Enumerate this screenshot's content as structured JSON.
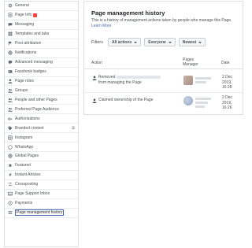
{
  "sidebar": {
    "items": [
      {
        "label": "General",
        "icon": "gear-icon"
      },
      {
        "label": "Page Info",
        "icon": "info-icon",
        "badge": true
      },
      {
        "label": "Messaging",
        "icon": "chat-icon"
      },
      {
        "label": "Templates and tabs",
        "icon": "grid-icon"
      },
      {
        "label": "Post attribution",
        "icon": "flag-icon"
      },
      {
        "label": "Notifications",
        "icon": "globe-icon"
      },
      {
        "label": "Advanced messaging",
        "icon": "chat-bubble-icon"
      },
      {
        "label": "Facebook badges",
        "icon": "badge-icon"
      },
      {
        "label": "Page roles",
        "icon": "person-icon"
      },
      {
        "label": "Groups",
        "icon": "people-icon"
      },
      {
        "label": "People and other Pages",
        "icon": "people-icon"
      },
      {
        "label": "Preferred Page Audience",
        "icon": "people-icon"
      },
      {
        "label": "Authorisations",
        "icon": "key-icon"
      },
      {
        "label": "Branded content",
        "icon": "tag-icon",
        "trail": "⧉"
      },
      {
        "label": "Instagram",
        "icon": "instagram-icon"
      },
      {
        "label": "WhatsApp",
        "icon": "whatsapp-icon"
      },
      {
        "label": "Global Pages",
        "icon": "globe-icon"
      },
      {
        "label": "Featured",
        "icon": "star-icon"
      },
      {
        "label": "Instant Articles",
        "icon": "lightning-icon"
      },
      {
        "label": "Crossposting",
        "icon": "crosspost-icon"
      },
      {
        "label": "Page Support Inbox",
        "icon": "inbox-icon"
      },
      {
        "label": "Payments",
        "icon": "dollar-icon"
      },
      {
        "label": "Page management history",
        "icon": "list-icon",
        "active": true
      }
    ]
  },
  "panel": {
    "title": "Page management history",
    "description": "This is a history of management actions taken by people who manage this Page.",
    "learn_more": "Learn More",
    "filters_label": "Filters",
    "filters": [
      "All actions",
      "Everyone",
      "Newest"
    ],
    "headers": {
      "action": "Action",
      "manager": "Pages Manager",
      "date": "Date"
    },
    "rows": [
      {
        "action_prefix": "Removed",
        "action_suffix": "from managing the Page",
        "date": "2 Dec 2019, 16:28"
      },
      {
        "action_prefix": "Claimed ownership of the Page",
        "action_suffix": "",
        "date": "2 Dec 2019, 16:26"
      }
    ]
  },
  "colors": {
    "accent": "#4267b2",
    "badge": "#fa3e3e",
    "border": "#dddfe2"
  }
}
